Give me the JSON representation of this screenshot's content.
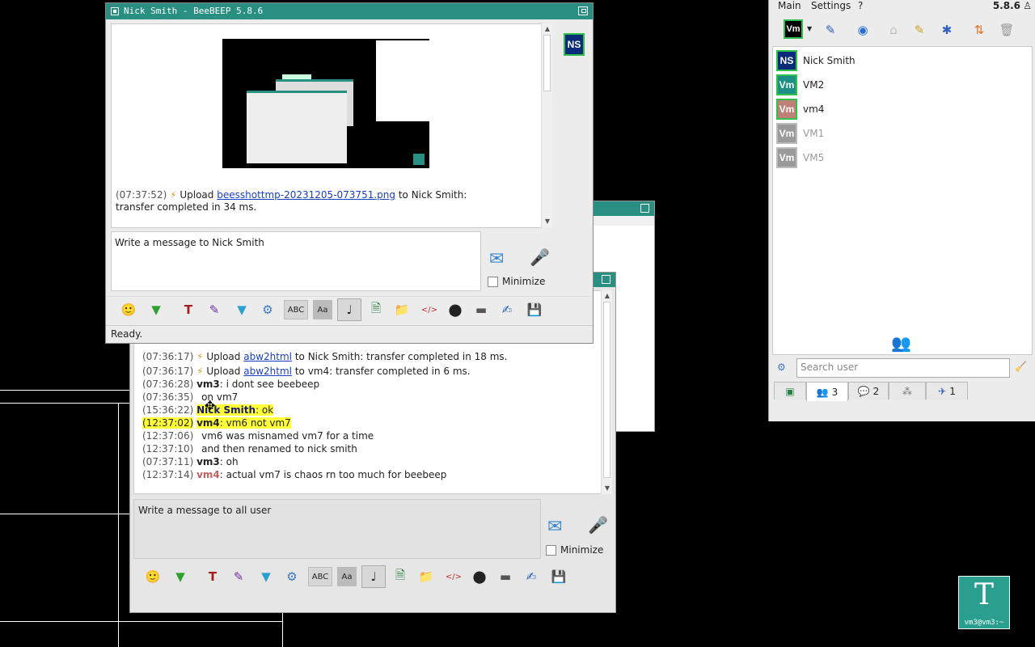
{
  "desktop": {
    "terminal_label": "vm3@vm3:~"
  },
  "main_window": {
    "menu": {
      "main": "Main",
      "settings": "Settings",
      "help": "?"
    },
    "version": "5.8.6",
    "status_avatar": "Vm",
    "users": [
      {
        "initials": "NS",
        "name": "Nick Smith",
        "color": "#0a2a7a",
        "border": "#2ec04a",
        "online": true
      },
      {
        "initials": "Vm",
        "name": "VM2",
        "color": "#1e8f86",
        "border": "#2ec04a",
        "online": true
      },
      {
        "initials": "Vm",
        "name": "vm4",
        "color": "#c08078",
        "border": "#2ec04a",
        "online": true
      },
      {
        "initials": "Vm",
        "name": "VM1",
        "color": "#9a9a9a",
        "border": "#bbbbbb",
        "online": false
      },
      {
        "initials": "Vm",
        "name": "VM5",
        "color": "#9a9a9a",
        "border": "#bbbbbb",
        "online": false
      }
    ],
    "search_placeholder": "Search user",
    "tabs": [
      {
        "icon": "users-icon",
        "count": "3"
      },
      {
        "icon": "chats-icon",
        "count": "2"
      },
      {
        "icon": "groups-icon",
        "count": ""
      },
      {
        "icon": "shares-icon",
        "count": "1"
      }
    ]
  },
  "private_chat": {
    "title": "Nick Smith - BeeBEEP 5.8.6",
    "side_avatar": "NS",
    "message": {
      "time": "(07:37:52)",
      "prefix": "Upload",
      "file": "beesshottmp-20231205-073751.png",
      "rest": "to Nick Smith: transfer completed in 34 ms."
    },
    "input_placeholder": "Write a message to Nick Smith",
    "minimize_label": "Minimize",
    "status": "Ready."
  },
  "group_chat": {
    "lines": [
      {
        "time": "(07:36:17)",
        "upload": "Upload",
        "file": "abw2html",
        "rest": "to Nick Smith: transfer completed in 18 ms."
      },
      {
        "time": "(07:36:17)",
        "upload": "Upload",
        "file": "abw2html",
        "rest": "to vm4: transfer completed in 6 ms."
      },
      {
        "time": "(07:36:28)",
        "user": "vm3",
        "text": ": i dont see beebeep"
      },
      {
        "time": "(07:36:35)",
        "text": "on vm7"
      },
      {
        "time": "(15:36:22)",
        "user": "Nick Smith",
        "text": ": ok"
      },
      {
        "time": "(12:37:02)",
        "user": "vm4",
        "text": ": vm6 not vm7"
      },
      {
        "time": "(12:37:06)",
        "text": "vm6 was misnamed vm7 for a time"
      },
      {
        "time": "(12:37:10)",
        "text": "and then renamed to nick smith"
      },
      {
        "time": "(07:37:11)",
        "user": "vm3",
        "text": ": oh"
      },
      {
        "time": "(12:37:14)",
        "user": "vm4",
        "text": ": actual vm7 is chaos rn too much for beebeep"
      }
    ],
    "input_placeholder": "Write a message to all user",
    "minimize_label": "Minimize"
  },
  "colors": {
    "accent": "#2a8f83",
    "highlight": "#ffff3a",
    "link": "#1a3fbf",
    "vm4": "#c06060"
  }
}
